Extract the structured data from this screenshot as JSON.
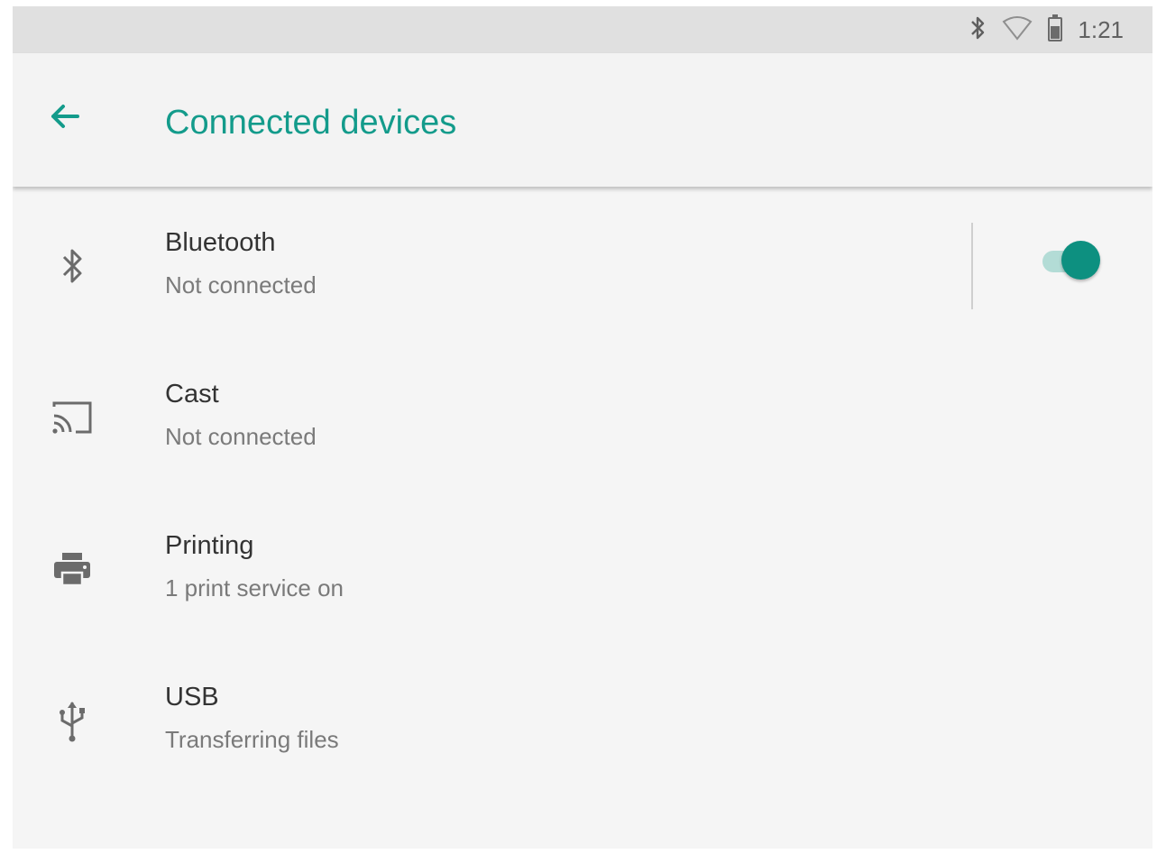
{
  "status_bar": {
    "time": "1:21",
    "icons": [
      "bluetooth-icon",
      "wifi-icon",
      "battery-icon"
    ]
  },
  "app_bar": {
    "title": "Connected devices",
    "back_icon": "back-arrow-icon"
  },
  "colors": {
    "accent": "#139b8b",
    "toggle_on": "#0d9080"
  },
  "settings": [
    {
      "id": "bluetooth",
      "icon": "bluetooth-icon",
      "title": "Bluetooth",
      "subtitle": "Not connected",
      "toggle": "on"
    },
    {
      "id": "cast",
      "icon": "cast-icon",
      "title": "Cast",
      "subtitle": "Not connected"
    },
    {
      "id": "printing",
      "icon": "printer-icon",
      "title": "Printing",
      "subtitle": "1 print service on"
    },
    {
      "id": "usb",
      "icon": "usb-icon",
      "title": "USB",
      "subtitle": "Transferring files"
    }
  ]
}
